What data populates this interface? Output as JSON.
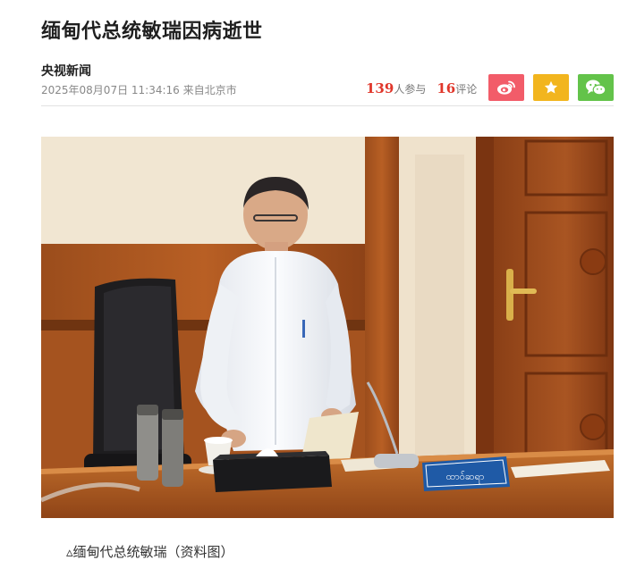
{
  "article": {
    "title": "缅甸代总统敏瑞因病逝世",
    "source": "央视新闻",
    "datetime": "2025年08月07日 11:34:16 来自北京市",
    "stats": {
      "participants": "139",
      "participants_label": "人参与",
      "comments": "16",
      "comments_label": "评论"
    },
    "share": {
      "weibo_icon": "weibo-icon",
      "favorite_icon": "star-icon",
      "wechat_icon": "wechat-icon",
      "colors": {
        "weibo": "#f25c69",
        "favorite": "#f2b51e",
        "wechat": "#63c34a"
      }
    },
    "photo": {
      "nameplate_text": "ထာဝ်ဆရာ",
      "caption": "▵缅甸代总统敏瑞（资料图）"
    }
  }
}
